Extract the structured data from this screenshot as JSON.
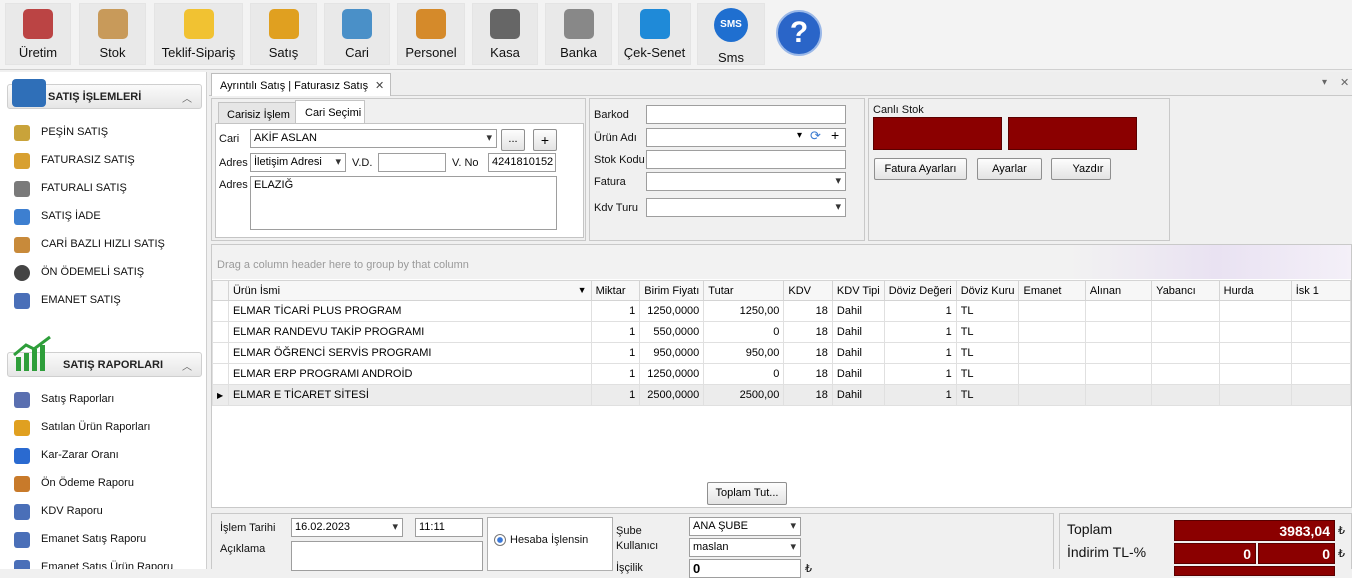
{
  "toolbar": {
    "buttons": [
      {
        "label": "Üretim",
        "icon": "factory-icon",
        "color": "#b44"
      },
      {
        "label": "Stok",
        "icon": "box-icon",
        "color": "#c89a5a"
      },
      {
        "label": "Teklif-Sipariş",
        "icon": "shopping-bag-icon",
        "color": "#f1c232"
      },
      {
        "label": "Satış",
        "icon": "cart-icon",
        "color": "#e0a020"
      },
      {
        "label": "Cari",
        "icon": "users-icon",
        "color": "#4a90c8"
      },
      {
        "label": "Personel",
        "icon": "person-icon",
        "color": "#d58a2a"
      },
      {
        "label": "Kasa",
        "icon": "safe-icon",
        "color": "#666"
      },
      {
        "label": "Banka",
        "icon": "bank-icon",
        "color": "#888"
      },
      {
        "label": "Çek-Senet",
        "icon": "book-icon",
        "color": "#1f8ad8"
      },
      {
        "label": "Sms",
        "icon": "sms-icon",
        "color": "#1f6fd0",
        "glyph": "SMS"
      },
      {
        "label": "",
        "icon": "help-icon",
        "color": "#2a65c8",
        "glyph": "?"
      }
    ]
  },
  "sidebar": {
    "group1": "SATIŞ İŞLEMLERİ",
    "group1_items": [
      {
        "label": "PEŞİN SATIŞ",
        "color": "#c9a33a"
      },
      {
        "label": "FATURASIZ SATIŞ",
        "color": "#d8a030"
      },
      {
        "label": "FATURALI SATIŞ",
        "color": "#7a7a7a"
      },
      {
        "label": "SATIŞ İADE",
        "color": "#3d7fd0"
      },
      {
        "label": "CARİ BAZLI HIZLI SATIŞ",
        "color": "#c88a3a"
      },
      {
        "label": "ÖN ÖDEMELİ SATIŞ",
        "color": "#444"
      },
      {
        "label": "EMANET SATIŞ",
        "color": "#4a6fb8"
      }
    ],
    "group2": "SATIŞ RAPORLARI",
    "group2_items": [
      {
        "label": "Satış Raporları",
        "color": "#5a6fb0"
      },
      {
        "label": "Satılan Ürün Raporları",
        "color": "#e0a020"
      },
      {
        "label": "Kar-Zarar Oranı",
        "color": "#2a6ad0"
      },
      {
        "label": "Ön Ödeme Raporu",
        "color": "#c87a2a"
      },
      {
        "label": "KDV Raporu",
        "color": "#4a6fb8"
      },
      {
        "label": "Emanet Satış Raporu",
        "color": "#4a6fb8"
      },
      {
        "label": "Emanet Satış Ürün Raporu",
        "color": "#4a6fb8"
      }
    ]
  },
  "doc_tab": {
    "label": "Ayrıntılı Satış | Faturasız Satış",
    "close": "✕"
  },
  "cari": {
    "tabs": [
      "Carisiz İşlem",
      "Cari Seçimi"
    ],
    "cari_label": "Cari",
    "cari_value": "AKİF ASLAN",
    "btn_more": "...",
    "btn_add": "+",
    "adres_label": "Adres",
    "adres_type": "İletişim Adresi",
    "vd_label": "V.D.",
    "vd_value": "",
    "vno_label": "V. No",
    "vno_value": "4241810152",
    "adres2_label": "Adres",
    "adres_value": "ELAZIĞ"
  },
  "product": {
    "barkod_label": "Barkod",
    "urun_adi_label": "Ürün Adı",
    "stok_kodu_label": "Stok Kodu",
    "fatura_label": "Fatura",
    "kdv_turu_label": "Kdv Turu"
  },
  "stock": {
    "title": "Canlı Stok",
    "fatura_ayarlari": "Fatura Ayarları",
    "ayarlar": "Ayarlar",
    "yazdir": "Yazdır"
  },
  "grid": {
    "group_hint": "Drag a column header here to group by that column",
    "columns": [
      "Ürün İsmi",
      "Miktar",
      "Birim Fiyatı",
      "Tutar",
      "KDV",
      "KDV Tipi",
      "Döviz Değeri",
      "Döviz Kuru",
      "Emanet",
      "Alınan",
      "Yabancı",
      "Hurda",
      "İsk 1"
    ],
    "rows": [
      [
        "ELMAR TİCARİ PLUS PROGRAM",
        "1",
        "1250,0000",
        "1250,00",
        "18",
        "Dahil",
        "1",
        "TL",
        "",
        "",
        "",
        "",
        ""
      ],
      [
        "ELMAR RANDEVU TAKİP PROGRAMI",
        "1",
        "550,0000",
        "0",
        "18",
        "Dahil",
        "1",
        "TL",
        "",
        "",
        "",
        "",
        ""
      ],
      [
        "ELMAR ÖĞRENCİ SERVİS PROGRAMI",
        "1",
        "950,0000",
        "950,00",
        "18",
        "Dahil",
        "1",
        "TL",
        "",
        "",
        "",
        "",
        ""
      ],
      [
        "ELMAR ERP PROGRAMI ANDROİD",
        "1",
        "1250,0000",
        "0",
        "18",
        "Dahil",
        "1",
        "TL",
        "",
        "",
        "",
        "",
        ""
      ],
      [
        "ELMAR E TİCARET  SİTESİ",
        "1",
        "2500,0000",
        "2500,00",
        "18",
        "Dahil",
        "1",
        "TL",
        "",
        "",
        "",
        "",
        ""
      ]
    ],
    "selected_row": 4,
    "total_button": "Toplam Tut..."
  },
  "footer": {
    "islem_tarihi_label": "İşlem Tarihi",
    "islem_tarihi": "16.02.2023",
    "saat": "11:11",
    "aciklama_label": "Açıklama",
    "hesaba_islensin": "Hesaba İşlensin",
    "sube_label": "Şube",
    "sube_value": "ANA ŞUBE",
    "kullanici_label": "Kullanıcı",
    "kullanici_value": "maslan",
    "iscilik_label": "İşçilik",
    "iscilik_value": "0",
    "toplam_label": "Toplam",
    "toplam_value": "3983,04",
    "indirim_label": "İndirim TL-%",
    "indirim_tl": "0",
    "indirim_pct": "0",
    "currency": "₺"
  }
}
